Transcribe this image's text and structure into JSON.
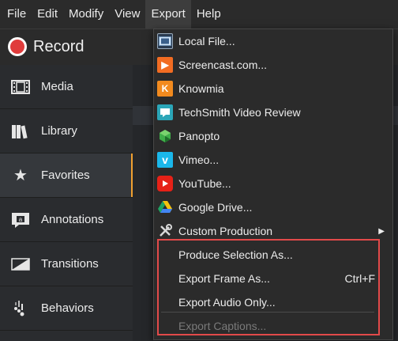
{
  "menubar": {
    "items": [
      "File",
      "Edit",
      "Modify",
      "View",
      "Export",
      "Help"
    ],
    "active": "Export"
  },
  "toolbar": {
    "record_label": "Record"
  },
  "sidebar": {
    "items": [
      {
        "label": "Media",
        "icon": "film-icon"
      },
      {
        "label": "Library",
        "icon": "books-icon"
      },
      {
        "label": "Favorites",
        "icon": "star-icon"
      },
      {
        "label": "Annotations",
        "icon": "annotation-icon"
      },
      {
        "label": "Transitions",
        "icon": "transition-icon"
      },
      {
        "label": "Behaviors",
        "icon": "behaviors-icon"
      }
    ],
    "selected": "Favorites"
  },
  "export_menu": {
    "items": [
      {
        "label": "Local File...",
        "icon": "local-file-icon"
      },
      {
        "label": "Screencast.com...",
        "icon": "screencast-icon"
      },
      {
        "label": "Knowmia",
        "icon": "knowmia-icon"
      },
      {
        "label": "TechSmith Video Review",
        "icon": "video-review-icon"
      },
      {
        "label": "Panopto",
        "icon": "panopto-icon"
      },
      {
        "label": "Vimeo...",
        "icon": "vimeo-icon"
      },
      {
        "label": "YouTube...",
        "icon": "youtube-icon"
      },
      {
        "label": "Google Drive...",
        "icon": "google-drive-icon"
      },
      {
        "label": "Custom Production",
        "icon": "tools-icon",
        "submenu": true
      },
      {
        "label": "Produce Selection As..."
      },
      {
        "label": "Export Frame As...",
        "shortcut": "Ctrl+F"
      },
      {
        "label": "Export Audio Only..."
      },
      {
        "label": "Export Captions...",
        "disabled": true
      }
    ]
  },
  "colors": {
    "record_red": "#e03b3b",
    "highlight_red": "#e24a4a",
    "selected_accent": "#f0a030",
    "screencast_orange": "#f26c22",
    "knowmia_orange": "#f28a1e",
    "video_review_teal": "#2ba6b8",
    "panopto_green": "#3fae49",
    "vimeo_blue": "#1ab7ea",
    "youtube_red": "#e62117"
  }
}
